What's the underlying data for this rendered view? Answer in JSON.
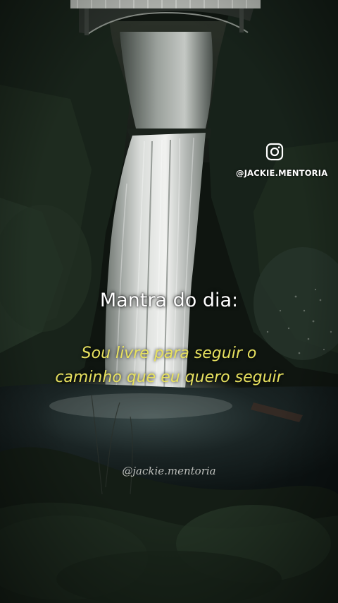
{
  "social": {
    "icon": "instagram-icon",
    "handle": "@JACKIE.MENTORIA"
  },
  "title": "Mantra do dia:",
  "mantra": {
    "line1": "Sou livre para seguir o",
    "line2": "caminho que eu quero seguir"
  },
  "watermark": "@jackie.mentoria",
  "colors": {
    "mantra_text": "#e7e15f",
    "title_text": "#ffffff",
    "background": "#0c110d"
  }
}
